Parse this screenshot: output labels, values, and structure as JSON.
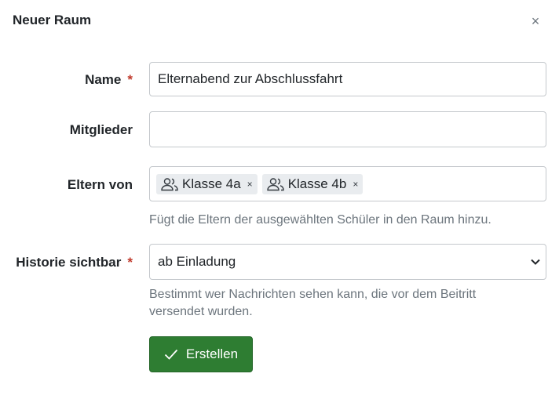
{
  "dialog": {
    "title": "Neuer Raum",
    "close_label": "×"
  },
  "form": {
    "required_mark": "*",
    "name": {
      "label": "Name",
      "value": "Elternabend zur Abschlussfahrt"
    },
    "members": {
      "label": "Mitglieder",
      "value": ""
    },
    "parents_of": {
      "label": "Eltern von",
      "tags": [
        {
          "label": "Klasse 4a",
          "icon": "users-icon",
          "remove": "×"
        },
        {
          "label": "Klasse 4b",
          "icon": "users-icon",
          "remove": "×"
        }
      ],
      "help": "Fügt die Eltern der ausgewählten Schüler in den Raum hinzu."
    },
    "history_visible": {
      "label": "Historie sichtbar",
      "selected": "ab Einladung",
      "help_line1": "Bestimmt wer Nachrichten sehen kann, die vor dem Beitritt",
      "help_line2": "versendet wurden."
    },
    "submit_label": "Erstellen"
  },
  "colors": {
    "primary_button": "#2e7d32",
    "required": "#c0392b",
    "help_text": "#6c757d"
  }
}
